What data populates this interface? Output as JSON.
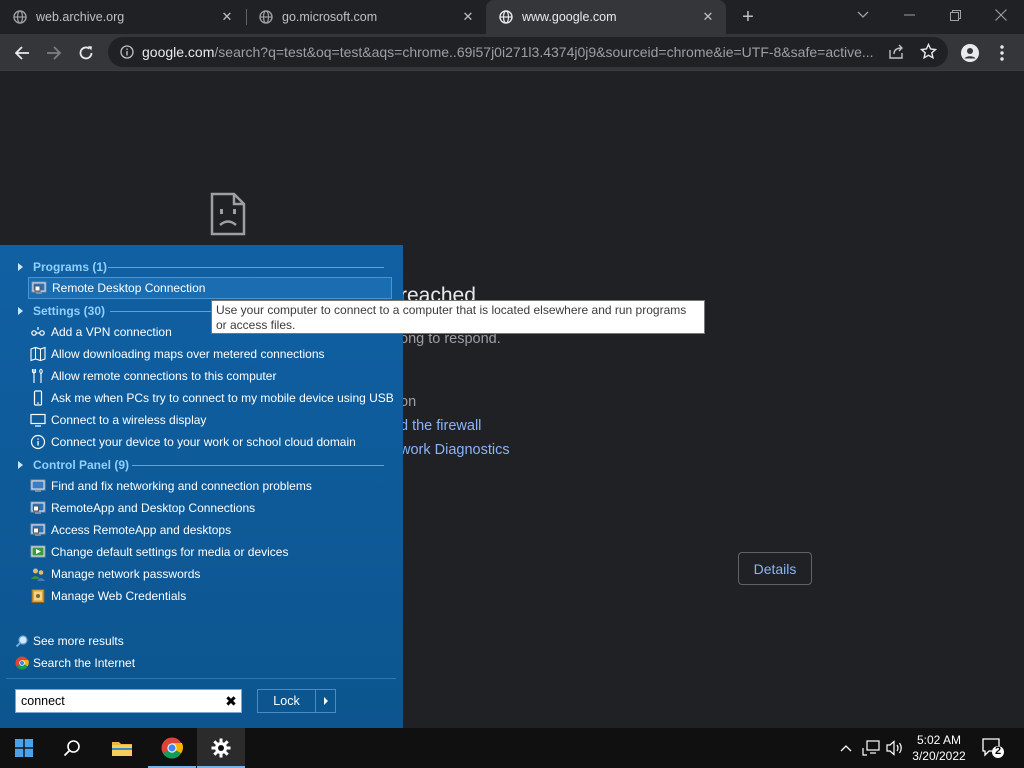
{
  "browser": {
    "tabs": [
      {
        "title": "web.archive.org",
        "active": false
      },
      {
        "title": "go.microsoft.com",
        "active": false
      },
      {
        "title": "www.google.com",
        "active": true
      }
    ],
    "url_host": "google.com",
    "url_rest": "/search?q=test&oq=test&aqs=chrome..69i57j0i271l3.4374j0j9&sourceid=chrome&ie=UTF-8&safe=active..."
  },
  "error_page": {
    "title_fragment": "reached",
    "line1_fragment": "ong to respond.",
    "line2_fragment": "on",
    "link1_fragment": "d the firewall",
    "link2_fragment": "work Diagnostics",
    "details_label": "Details"
  },
  "start_menu": {
    "programs_header": "Programs (1)",
    "programs": [
      {
        "label": "Remote Desktop Connection",
        "icon": "remote-desktop-icon"
      }
    ],
    "settings_header": "Settings (30)",
    "settings": [
      {
        "label": "Add a VPN connection",
        "icon": "vpn-icon"
      },
      {
        "label": "Allow downloading maps over metered connections",
        "icon": "map-icon"
      },
      {
        "label": "Allow remote connections to this computer",
        "icon": "remote-tools-icon"
      },
      {
        "label": "Ask me when PCs try to connect to my mobile device using USB",
        "icon": "phone-icon"
      },
      {
        "label": "Connect to a wireless display",
        "icon": "display-icon"
      },
      {
        "label": "Connect your device to your work or school cloud domain",
        "icon": "info-icon"
      }
    ],
    "control_panel_header": "Control Panel (9)",
    "control_panel": [
      {
        "label": "Find and fix networking and connection problems",
        "icon": "network-troubleshoot-icon"
      },
      {
        "label": "RemoteApp and Desktop Connections",
        "icon": "remoteapp-icon"
      },
      {
        "label": "Access RemoteApp and desktops",
        "icon": "remoteapp-access-icon"
      },
      {
        "label": "Change default settings for media or devices",
        "icon": "autoplay-icon"
      },
      {
        "label": "Manage network passwords",
        "icon": "users-icon"
      },
      {
        "label": "Manage Web Credentials",
        "icon": "credential-icon"
      }
    ],
    "see_more": "See more results",
    "search_internet": "Search the Internet",
    "search_value": "connect",
    "lock_label": "Lock"
  },
  "tooltip": {
    "text": "Use your computer to connect to a computer that is located elsewhere and run programs or access files."
  },
  "taskbar": {
    "time": "5:02 AM",
    "date": "3/20/2022",
    "notification_count": "2"
  },
  "colors": {
    "start_menu_bg": "#0f5c9c",
    "header_text": "#8fd0ff",
    "link": "#8ab4f8",
    "browser_bg": "#202124"
  }
}
